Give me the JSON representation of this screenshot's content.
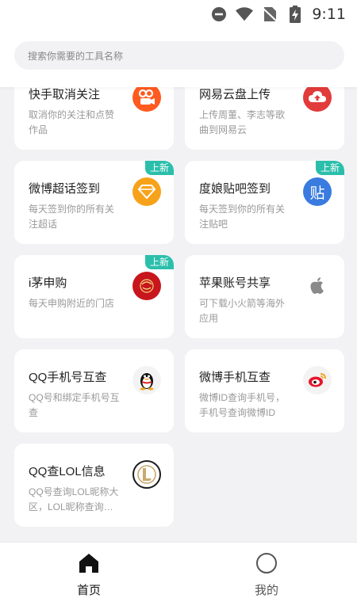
{
  "status_bar": {
    "time": "9:11"
  },
  "search": {
    "placeholder": "搜索你需要的工具名称"
  },
  "tools": [
    {
      "title": "快手取消关注",
      "desc": "取消你的关注和点赞作品",
      "badge": "",
      "icon": "kuaishou-icon",
      "color": "#ff5a1f"
    },
    {
      "title": "网易云盘上传",
      "desc": "上传周董、李志等歌曲到网易云",
      "badge": "",
      "icon": "netease-cloud-icon",
      "color": "#e23b3b"
    },
    {
      "title": "微博超话签到",
      "desc": "每天签到你的所有关注超话",
      "badge": "上新",
      "icon": "diamond-icon",
      "color": "#f7a21b"
    },
    {
      "title": "度娘贴吧签到",
      "desc": "每天签到你的所有关注贴吧",
      "badge": "上新",
      "icon": "tieba-icon",
      "color": "#3a7be0"
    },
    {
      "title": "i茅申购",
      "desc": "每天申购附近的门店",
      "badge": "上新",
      "icon": "moutai-icon",
      "color": "#c8161d"
    },
    {
      "title": "苹果账号共享",
      "desc": "可下载小火箭等海外应用",
      "badge": "",
      "icon": "apple-icon",
      "color": "#888888"
    },
    {
      "title": "QQ手机号互查",
      "desc": "QQ号和绑定手机号互查",
      "badge": "",
      "icon": "qq-penguin-icon",
      "color": "#222222"
    },
    {
      "title": "微博手机互查",
      "desc": "微博ID查询手机号，手机号查询微博ID",
      "badge": "",
      "icon": "weibo-icon",
      "color": "#e6162d"
    },
    {
      "title": "QQ查LOL信息",
      "desc": "QQ号查询LOL昵称大区，LOL昵称查询…",
      "badge": "",
      "icon": "lol-icon",
      "color": "#c8aa6e"
    }
  ],
  "nav": {
    "home_label": "首页",
    "mine_label": "我的"
  },
  "colors": {
    "badge": "#2bbfab",
    "background": "#f2f2f4"
  }
}
